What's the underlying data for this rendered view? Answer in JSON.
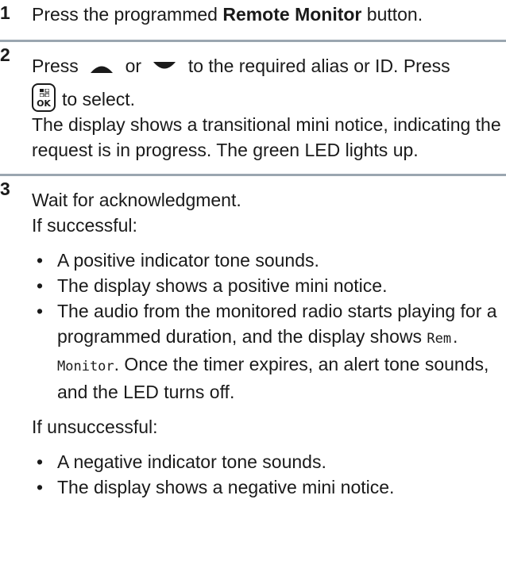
{
  "steps": [
    {
      "number": "1",
      "text_before": "Press the programmed ",
      "bold": "Remote Monitor",
      "text_after": " button."
    },
    {
      "number": "2",
      "line1_a": "Press",
      "line1_b": "or",
      "line1_c": "to the required alias or ID. Press",
      "ok_key_label": "OK",
      "line2": "to select.",
      "line3": "The display shows a transitional mini notice, indicating the request is in progress. The green LED lights up."
    },
    {
      "number": "3",
      "line1": "Wait for acknowledgment.",
      "success_label": "If successful:",
      "success_items": [
        "A positive indicator tone sounds.",
        "The display shows a positive mini notice."
      ],
      "success_item3_a": "The audio from the monitored radio starts playing for a programmed duration, and the display shows ",
      "success_item3_mono": "Rem. Monitor",
      "success_item3_b": ". Once the timer expires, an alert tone sounds, and the LED turns off.",
      "fail_label": "If unsuccessful:",
      "fail_items": [
        "A negative indicator tone sounds.",
        "The display shows a negative mini notice."
      ]
    }
  ],
  "icons": {
    "up": "up-arrow-icon",
    "down": "down-arrow-icon",
    "ok": "menu-ok-key-icon"
  }
}
